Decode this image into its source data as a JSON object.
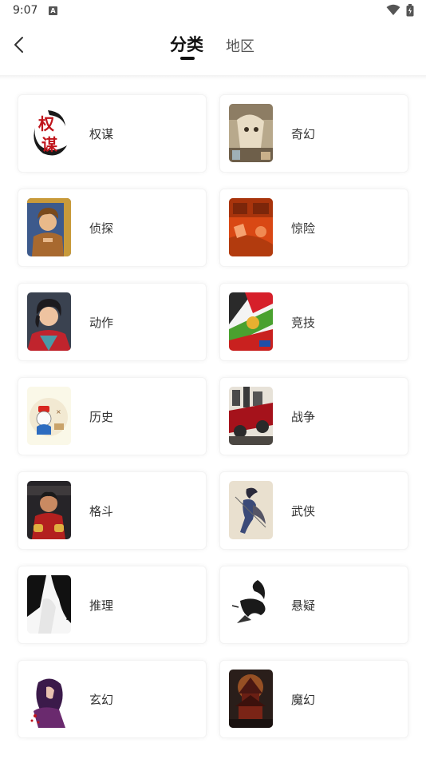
{
  "status_bar": {
    "time": "9:07",
    "notification_letter": "A"
  },
  "header": {
    "tabs": [
      {
        "label": "分类",
        "active": true
      },
      {
        "label": "地区",
        "active": false
      }
    ]
  },
  "categories": [
    {
      "label": "权谋",
      "thumb": "quanmou"
    },
    {
      "label": "奇幻",
      "thumb": "qihuan"
    },
    {
      "label": "侦探",
      "thumb": "zhentan"
    },
    {
      "label": "惊险",
      "thumb": "jingxian"
    },
    {
      "label": "动作",
      "thumb": "dongzuo"
    },
    {
      "label": "竞技",
      "thumb": "jingji"
    },
    {
      "label": "历史",
      "thumb": "lishi"
    },
    {
      "label": "战争",
      "thumb": "zhanzheng"
    },
    {
      "label": "格斗",
      "thumb": "gedou"
    },
    {
      "label": "武侠",
      "thumb": "wuxia"
    },
    {
      "label": "推理",
      "thumb": "tuili"
    },
    {
      "label": "悬疑",
      "thumb": "xuanyi"
    },
    {
      "label": "玄幻",
      "thumb": "xuanhuan"
    },
    {
      "label": "魔幻",
      "thumb": "mohuan"
    }
  ],
  "thumb_text": {
    "quanmou_1": "权",
    "quanmou_2": "谋"
  },
  "colors": {
    "active_tab": "#111111",
    "inactive_tab": "#555555",
    "label": "#333333"
  }
}
